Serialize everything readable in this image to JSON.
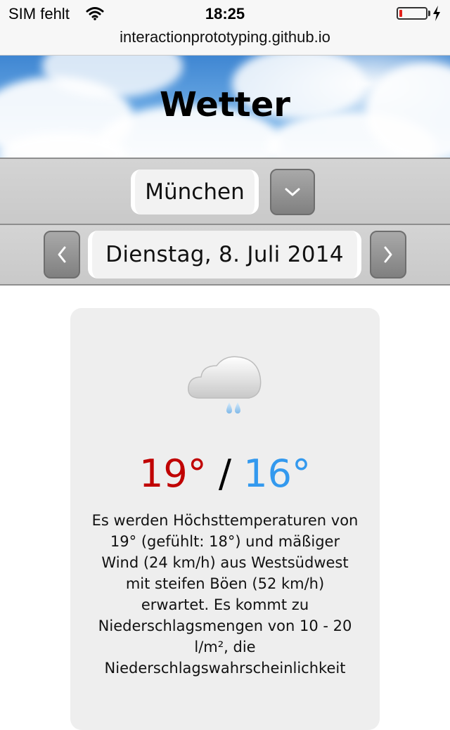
{
  "status_bar": {
    "carrier": "SIM fehlt",
    "time": "18:25",
    "battery_level": 0.1,
    "battery_color": "#e3211c"
  },
  "browser": {
    "url": "interactionprototyping.github.io"
  },
  "header": {
    "title": "Wetter"
  },
  "city_selector": {
    "value": "München",
    "dropdown_icon": "chevron-down-icon"
  },
  "date_selector": {
    "value": "Dienstag, 8. Juli 2014",
    "prev_icon": "chevron-left-icon",
    "next_icon": "chevron-right-icon"
  },
  "forecast": {
    "icon": "cloud-rain-icon",
    "high": "19°",
    "separator": "/",
    "low": "16°",
    "high_color": "#c00000",
    "low_color": "#3399ee",
    "description": "Es werden Höchsttemperaturen von 19° (gefühlt: 18°) und mäßiger Wind (24 km/h) aus Westsüdwest mit steifen Böen (52 km/h) erwartet. Es kommt zu Niederschlagsmengen von 10 - 20 l/m², die Niederschlagswahrscheinlichkeit"
  }
}
